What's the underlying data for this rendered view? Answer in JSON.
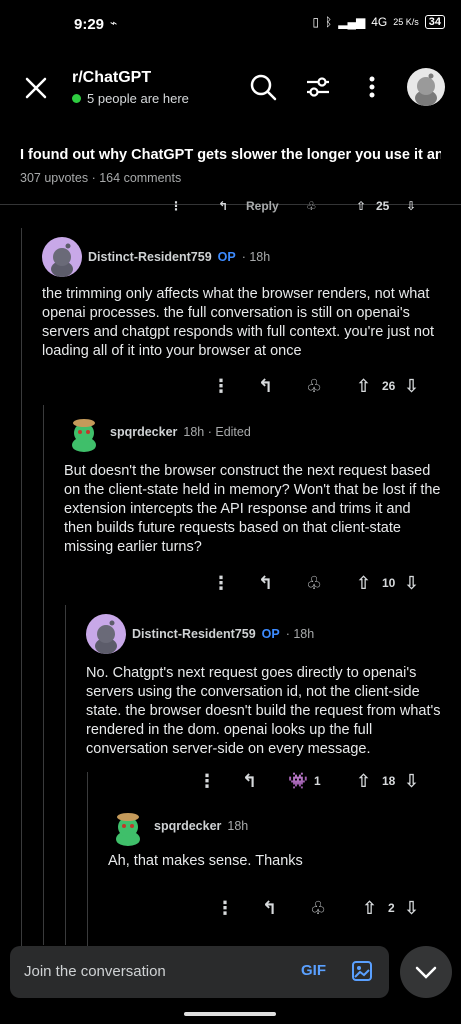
{
  "status": {
    "time": "9:29",
    "network": "4G",
    "speed": "25 K/s",
    "battery": "34"
  },
  "header": {
    "subreddit": "r/ChatGPT",
    "online": "5 people are here"
  },
  "post": {
    "title": "I found out why ChatGPT gets slower the longer you use it an...",
    "upvotes": "307 upvotes",
    "comments": "164 comments"
  },
  "partial_row": {
    "reply": "Reply",
    "votes": "25"
  },
  "comments": [
    {
      "author": "Distinct-Resident759",
      "op": "OP",
      "meta": "· 18h",
      "body": "the trimming only affects what the browser renders, not what openai processes. the full conversation is still on openai's servers and chatgpt responds with full context. you're just not loading all of it into your browser at once",
      "votes": "26"
    },
    {
      "author": "spqrdecker",
      "meta": "18h · Edited",
      "body": "But doesn't the browser construct the next request based on the client-state held in memory? Won't that be lost if the extension intercepts the API response and trims it and then builds future requests based on that client-state missing earlier turns?",
      "votes": "10"
    },
    {
      "author": "Distinct-Resident759",
      "op": "OP",
      "meta": "· 18h",
      "body": "No. Chatgpt's next request goes directly to openai's servers using the conversation id, not the client-side state. the browser doesn't build the request from what's rendered in the dom. openai looks up the full conversation server-side on every message.",
      "award_count": "1",
      "votes": "18"
    },
    {
      "author": "spqrdecker",
      "meta": "18h",
      "body": "Ah, that makes sense. Thanks",
      "votes": "2"
    }
  ],
  "composer": {
    "placeholder": "Join the conversation",
    "gif": "GIF"
  },
  "colors": {
    "accent": "#3d8bff",
    "online": "#2ecc40",
    "background": "#000000"
  }
}
